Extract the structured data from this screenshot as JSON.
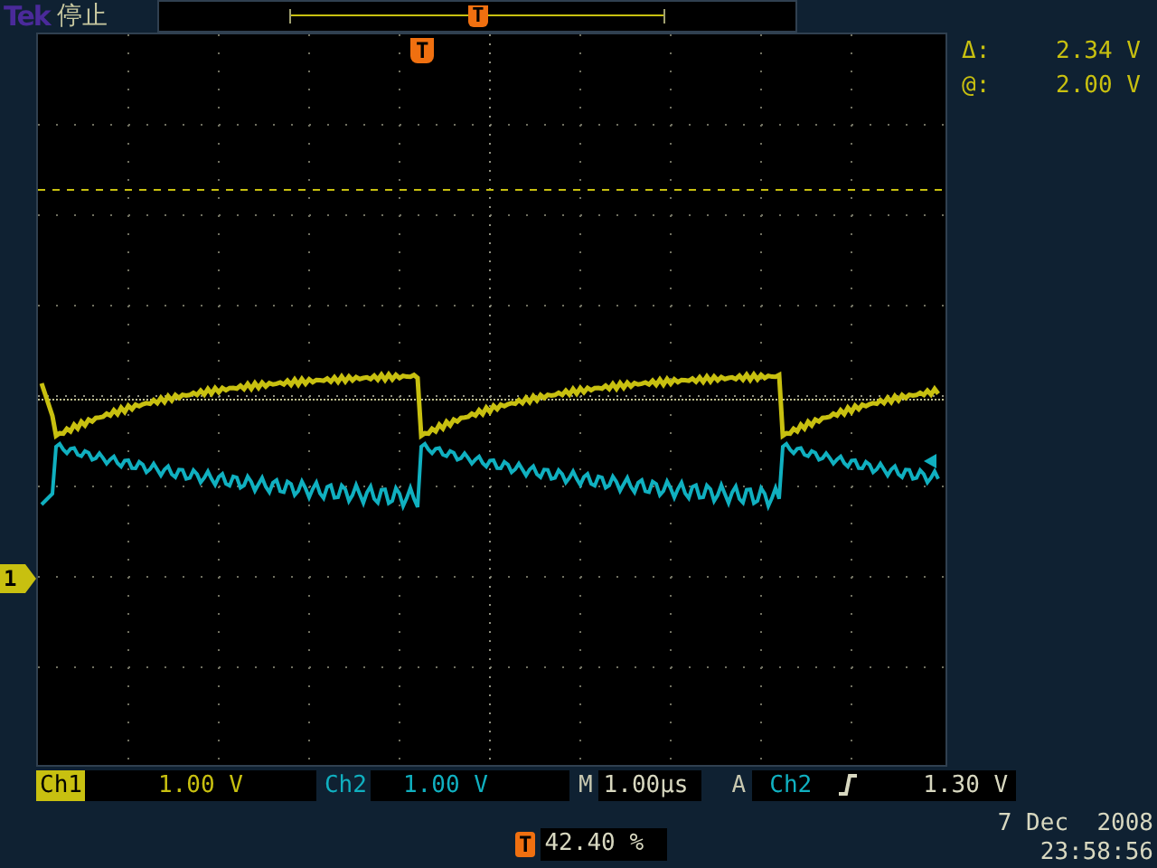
{
  "top_bar": {
    "brand": "Tek",
    "status": "停止",
    "record_trigger_marker": "T"
  },
  "scope": {
    "trigger_marker": "T",
    "channel_marker": "1"
  },
  "readouts": [
    {
      "label": "Δ:",
      "value": "2.34 V"
    },
    {
      "label": "@:",
      "value": "2.00 V"
    }
  ],
  "channels": [
    {
      "name": "Ch1",
      "scale": "1.00 V",
      "color": "#c8c010"
    },
    {
      "name": "Ch2",
      "scale": "1.00 V",
      "color": "#10b0c0"
    }
  ],
  "timebase": {
    "label": "M",
    "value": "1.00µs"
  },
  "trigger": {
    "label": "A",
    "source": "Ch2",
    "rising_edge": true,
    "level": "1.30 V"
  },
  "trigger_position": {
    "marker": "T",
    "value": "42.40 %"
  },
  "date": "7 Dec  2008",
  "time": "23:58:56"
}
